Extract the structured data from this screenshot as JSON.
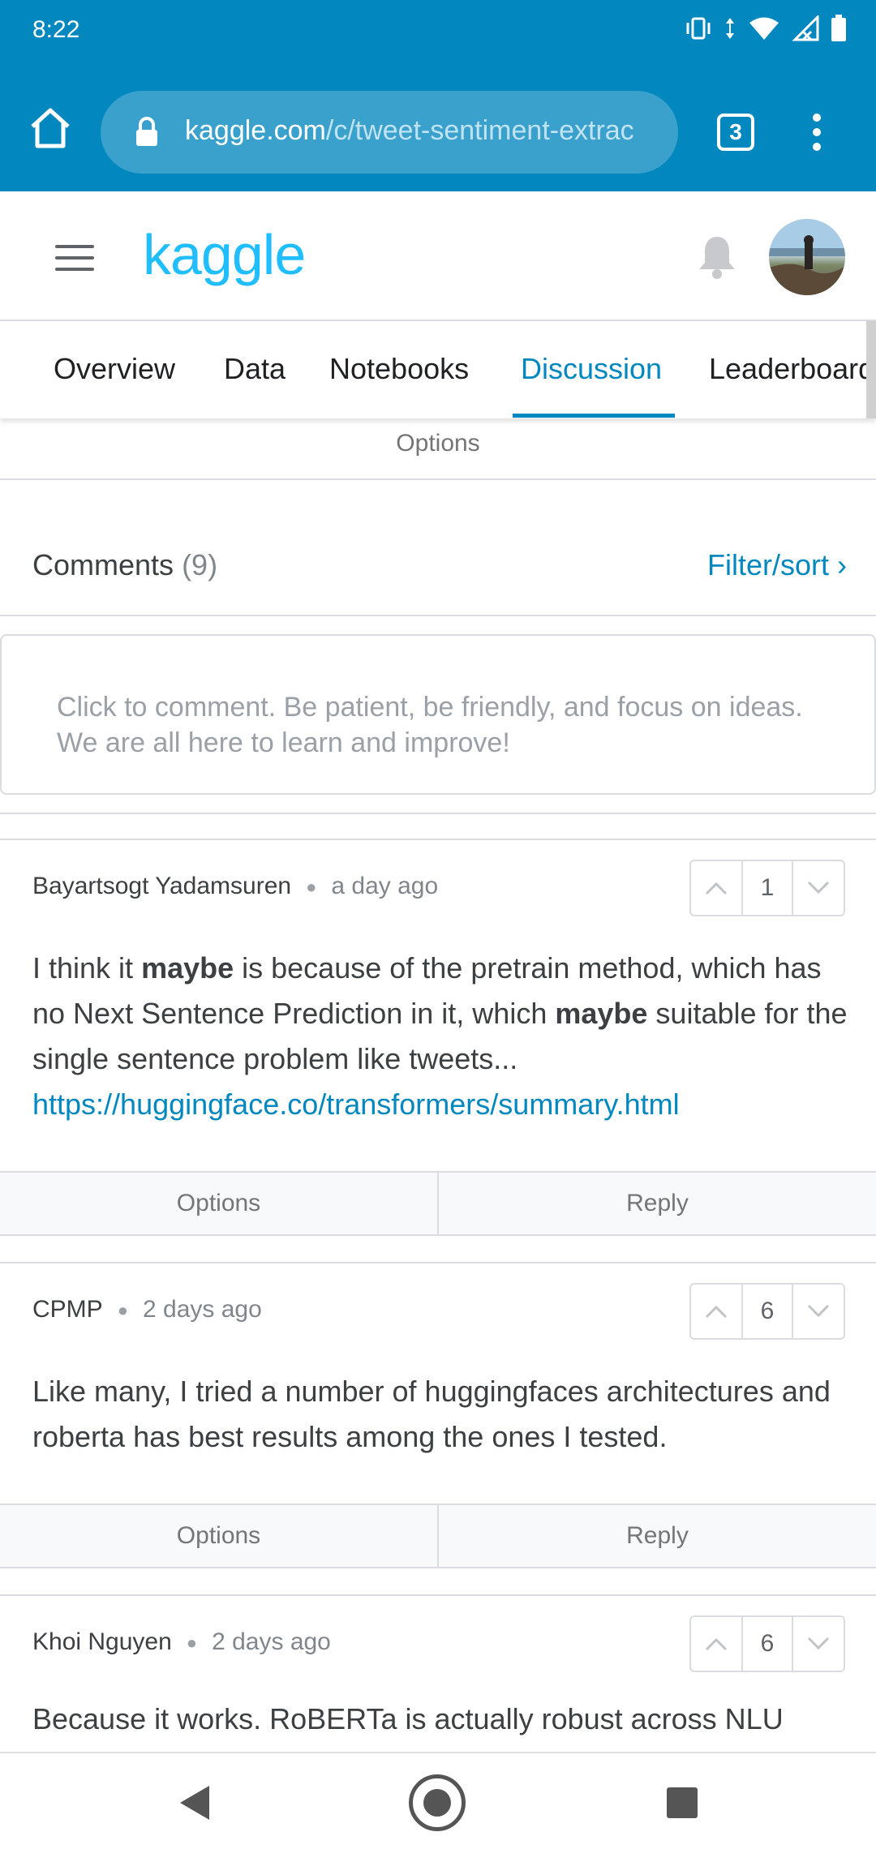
{
  "status_bar": {
    "time": "8:22",
    "icons": [
      "vibrate-icon",
      "data-arrows-icon",
      "wifi-icon",
      "signal-icon",
      "battery-icon"
    ]
  },
  "browser": {
    "url_domain": "kaggle.com",
    "url_path": "/c/tweet-sentiment-extrac",
    "tab_count": "3"
  },
  "header": {
    "logo": "kaggle"
  },
  "nav": {
    "tabs": [
      {
        "label": "Overview"
      },
      {
        "label": "Data"
      },
      {
        "label": "Notebooks"
      },
      {
        "label": "Discussion",
        "active": true
      },
      {
        "label": "Leaderboard"
      }
    ]
  },
  "top_options_label": "Options",
  "comments": {
    "title": "Comments",
    "count": "(9)",
    "filter_label": "Filter/sort",
    "filter_chevron": "›",
    "input_placeholder": "Click to comment. Be patient, be friendly, and focus on ideas. We are all here to learn and improve!",
    "items": [
      {
        "author": "Bayartsogt Yadamsuren",
        "when": "a day ago",
        "votes": "1",
        "body_1": "I think it ",
        "body_b1": "maybe",
        "body_2": " is because of the pretrain method, which has no Next Sentence Prediction in it, which ",
        "body_b2": "maybe",
        "body_3": " suitable for the single sentence problem like tweets...",
        "link": "https://huggingface.co/transformers/summary.html",
        "options_label": "Options",
        "reply_label": "Reply"
      },
      {
        "author": "CPMP",
        "when": "2 days ago",
        "votes": "6",
        "body": "Like many, I tried a number of huggingfaces architectures and roberta has best results among the ones I tested.",
        "options_label": "Options",
        "reply_label": "Reply"
      },
      {
        "author": "Khoi Nguyen",
        "when": "2 days ago",
        "votes": "6",
        "body": "Because it works. RoBERTa is actually robust across NLU"
      }
    ]
  },
  "colors": {
    "browser_bar": "#0288bf",
    "kaggle_blue": "#20beff",
    "link": "#0288bf"
  }
}
